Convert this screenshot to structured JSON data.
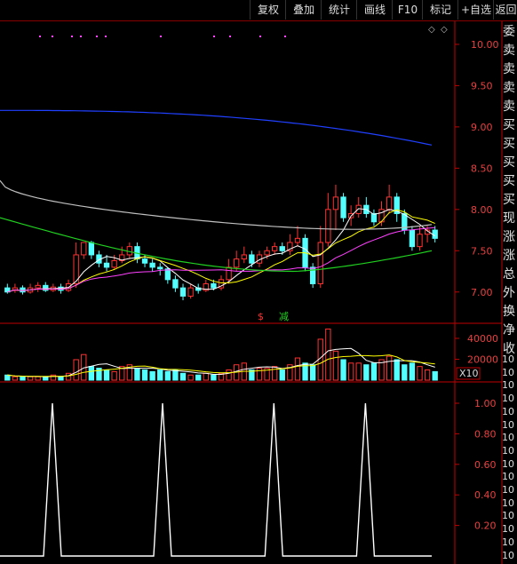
{
  "toolbar": {
    "buttons": [
      "复权",
      "叠加",
      "统计",
      "画线",
      "F10",
      "标记",
      "+自选",
      "返回"
    ]
  },
  "price_axis": {
    "labels": [
      "10.00",
      "9.50",
      "9.00",
      "8.50",
      "8.00",
      "7.50",
      "7.00"
    ],
    "values": [
      10.0,
      9.5,
      9.0,
      8.5,
      8.0,
      7.5,
      7.0
    ]
  },
  "volume_axis": {
    "labels": [
      "40000",
      "20000"
    ],
    "unit": "X10"
  },
  "indicator_axis": {
    "labels": [
      "1.00",
      "0.80",
      "0.60",
      "0.40",
      "0.20"
    ],
    "values": [
      1.0,
      0.8,
      0.6,
      0.4,
      0.2
    ]
  },
  "right_panel": {
    "items": [
      "委",
      "卖",
      "卖",
      "卖",
      "卖",
      "买",
      "买",
      "买",
      "买",
      "买",
      "现",
      "涨",
      "涨",
      "总",
      "外",
      "换",
      "净",
      "收"
    ],
    "side_numbers": [
      "10",
      "10",
      "10",
      "10",
      "10",
      "10",
      "10",
      "10",
      "10",
      "10",
      "10",
      "10",
      "10",
      "10",
      "10",
      "10"
    ]
  },
  "annotations": {
    "mark1": "$",
    "mark2": "减"
  },
  "colors": {
    "up": "#ff3232",
    "down": "#54ffff",
    "ma5": "#ffffff",
    "ma10": "#ffff00",
    "ma20": "#ff40ff",
    "ma60": "#20d020",
    "ma120": "#c0c0c0",
    "ma250": "#2040ff",
    "axis": "#c00000",
    "indicator": "#ffffff"
  },
  "chart_data": {
    "type": "candlestick",
    "price_range": [
      6.75,
      10.15
    ],
    "candles": [
      [
        7.05,
        7.0,
        7.1,
        6.98
      ],
      [
        7.02,
        7.05,
        7.1,
        6.99
      ],
      [
        7.05,
        7.0,
        7.08,
        6.97
      ],
      [
        7.0,
        7.05,
        7.1,
        6.98
      ],
      [
        7.05,
        7.08,
        7.12,
        7.0
      ],
      [
        7.08,
        7.02,
        7.12,
        7.0
      ],
      [
        7.02,
        7.06,
        7.1,
        7.0
      ],
      [
        7.06,
        7.02,
        7.1,
        6.98
      ],
      [
        7.02,
        7.1,
        7.15,
        7.0
      ],
      [
        7.1,
        7.45,
        7.6,
        7.05
      ],
      [
        7.45,
        7.6,
        7.6,
        7.4
      ],
      [
        7.6,
        7.45,
        7.62,
        7.4
      ],
      [
        7.45,
        7.35,
        7.5,
        7.3
      ],
      [
        7.35,
        7.3,
        7.45,
        7.25
      ],
      [
        7.3,
        7.38,
        7.45,
        7.28
      ],
      [
        7.38,
        7.45,
        7.55,
        7.35
      ],
      [
        7.45,
        7.55,
        7.6,
        7.4
      ],
      [
        7.55,
        7.4,
        7.6,
        7.35
      ],
      [
        7.4,
        7.35,
        7.45,
        7.3
      ],
      [
        7.35,
        7.3,
        7.4,
        7.25
      ],
      [
        7.3,
        7.28,
        7.35,
        7.2
      ],
      [
        7.28,
        7.15,
        7.3,
        7.1
      ],
      [
        7.15,
        7.05,
        7.2,
        7.0
      ],
      [
        7.05,
        6.95,
        7.1,
        6.9
      ],
      [
        6.95,
        7.05,
        7.1,
        6.92
      ],
      [
        7.05,
        7.02,
        7.1,
        6.98
      ],
      [
        7.02,
        7.1,
        7.15,
        7.0
      ],
      [
        7.1,
        7.05,
        7.15,
        7.02
      ],
      [
        7.05,
        7.15,
        7.2,
        7.02
      ],
      [
        7.15,
        7.3,
        7.4,
        7.1
      ],
      [
        7.3,
        7.4,
        7.5,
        7.25
      ],
      [
        7.4,
        7.45,
        7.55,
        7.35
      ],
      [
        7.45,
        7.35,
        7.5,
        7.3
      ],
      [
        7.35,
        7.45,
        7.5,
        7.3
      ],
      [
        7.45,
        7.5,
        7.55,
        7.4
      ],
      [
        7.5,
        7.55,
        7.6,
        7.45
      ],
      [
        7.55,
        7.5,
        7.6,
        7.45
      ],
      [
        7.5,
        7.6,
        7.7,
        7.45
      ],
      [
        7.6,
        7.65,
        7.8,
        7.55
      ],
      [
        7.65,
        7.3,
        7.7,
        7.25
      ],
      [
        7.3,
        7.1,
        7.35,
        7.05
      ],
      [
        7.1,
        7.6,
        7.8,
        7.05
      ],
      [
        7.6,
        8.0,
        8.2,
        7.55
      ],
      [
        8.0,
        8.15,
        8.3,
        7.75
      ],
      [
        8.15,
        7.9,
        8.2,
        7.85
      ],
      [
        7.9,
        7.95,
        8.05,
        7.8
      ],
      [
        7.95,
        8.05,
        8.15,
        7.9
      ],
      [
        8.05,
        7.95,
        8.15,
        7.9
      ],
      [
        7.95,
        7.85,
        8.0,
        7.8
      ],
      [
        7.85,
        8.0,
        8.1,
        7.8
      ],
      [
        8.0,
        8.15,
        8.3,
        7.95
      ],
      [
        8.15,
        7.95,
        8.2,
        7.85
      ],
      [
        7.95,
        7.75,
        8.0,
        7.7
      ],
      [
        7.75,
        7.55,
        7.8,
        7.5
      ],
      [
        7.55,
        7.7,
        7.8,
        7.5
      ],
      [
        7.7,
        7.75,
        7.8,
        7.6
      ],
      [
        7.75,
        7.65,
        7.8,
        7.6
      ]
    ],
    "volume": [
      3,
      2,
      2,
      2,
      2,
      2,
      3,
      2,
      4,
      12,
      15,
      8,
      7,
      6,
      5,
      8,
      9,
      7,
      6,
      5,
      6,
      5,
      6,
      4,
      3,
      3,
      4,
      3,
      4,
      6,
      9,
      10,
      6,
      7,
      7,
      8,
      6,
      9,
      13,
      10,
      9,
      24,
      30,
      17,
      12,
      10,
      10,
      9,
      10,
      12,
      14,
      12,
      9,
      10,
      8,
      6,
      5
    ],
    "indicator_spikes_x": [
      0.105,
      0.36,
      0.618,
      0.83
    ]
  }
}
